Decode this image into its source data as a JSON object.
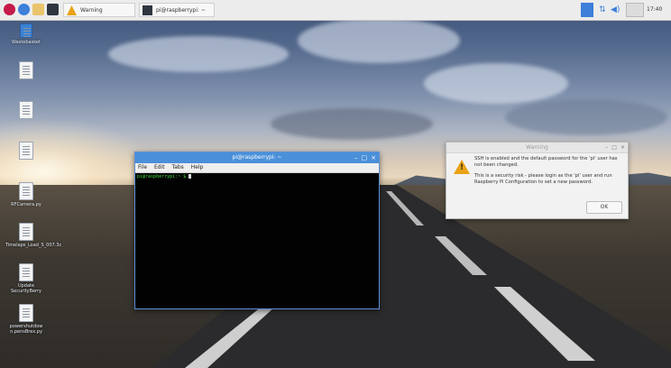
{
  "taskbar": {
    "menu_icon": "raspberry-icon",
    "tasks": [
      {
        "label": "Warning",
        "icon": "warning-icon"
      },
      {
        "label": "pi@raspberrypi: ~",
        "icon": "terminal-icon"
      }
    ],
    "clock": "17:40",
    "colors": {
      "bar": "#ececec"
    }
  },
  "desktop": {
    "icons": [
      {
        "label": "Wastebasket",
        "icon": "trash-icon"
      },
      {
        "label": "",
        "icon": "file-icon"
      },
      {
        "label": "",
        "icon": "file-icon"
      },
      {
        "label": "",
        "icon": "file-icon"
      },
      {
        "label": "RFCamera.py",
        "icon": "file-icon"
      },
      {
        "label": "Timelaps_Load_S_007.3c",
        "icon": "file-icon"
      },
      {
        "label": "Update SecurityBerry",
        "icon": "file-icon"
      },
      {
        "label": "powershutdow n.pensBrex.py",
        "icon": "file-icon"
      }
    ]
  },
  "terminal": {
    "title": "pi@raspberrypi: ~",
    "menu": [
      "File",
      "Edit",
      "Tabs",
      "Help"
    ],
    "prompt": "pi@raspberrypi:~ $"
  },
  "warning": {
    "title": "Warning",
    "message1": "SSH is enabled and the default password for the 'pi' user has not been changed.",
    "message2": "This is a security risk - please login as the 'pi' user and run Raspberry Pi Configuration to set a new password.",
    "ok": "OK",
    "accent": "#e8a317"
  }
}
